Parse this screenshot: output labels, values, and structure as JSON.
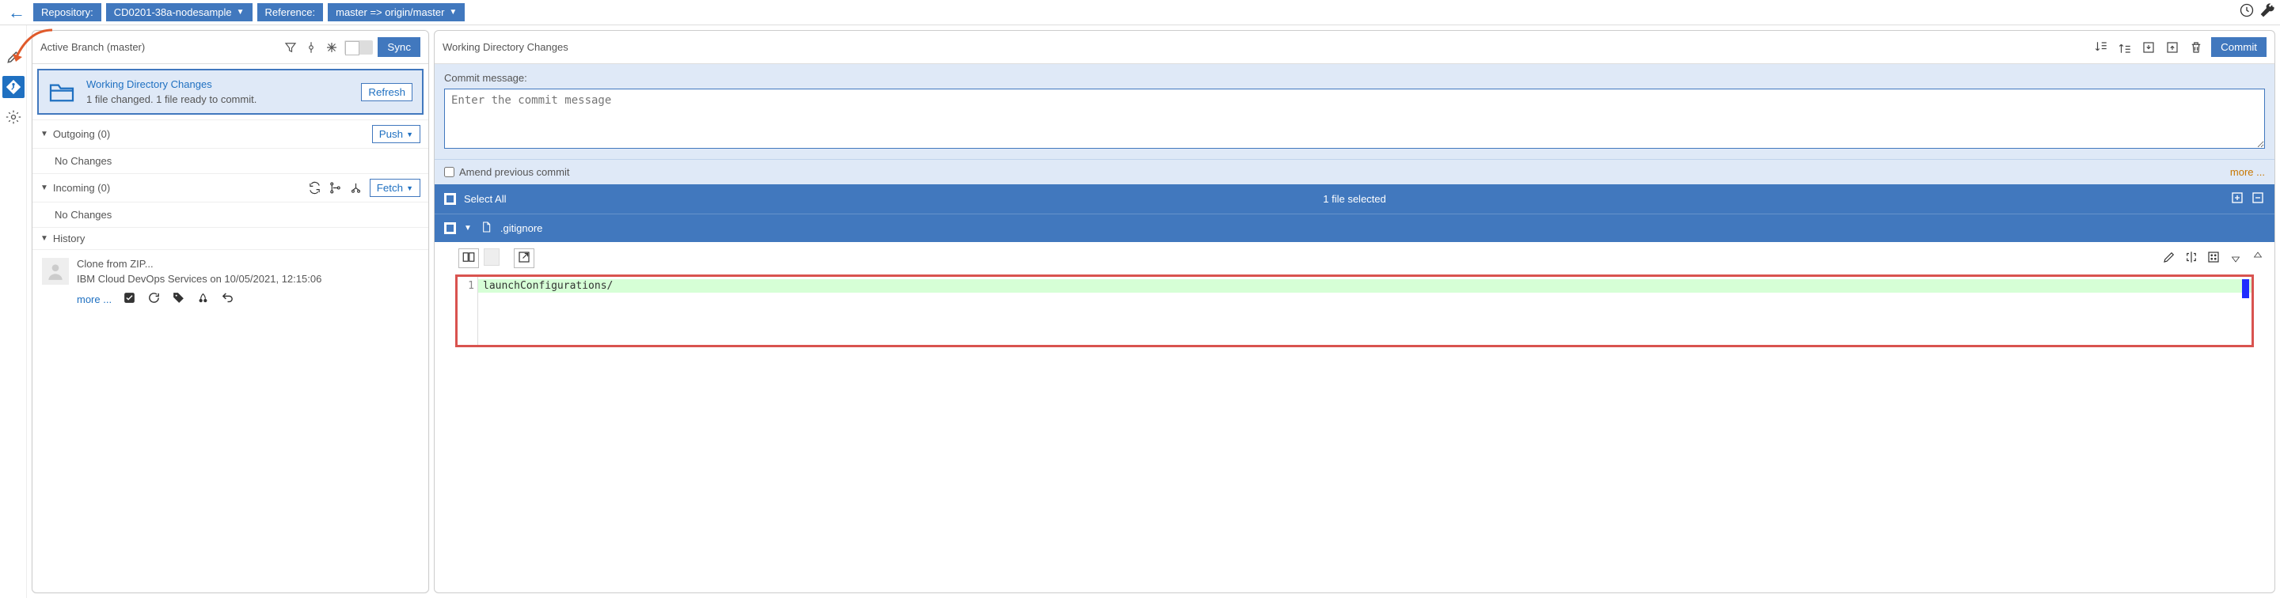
{
  "topbar": {
    "repo_label": "Repository:",
    "repo_value": "CD0201-38a-nodesample",
    "ref_label": "Reference:",
    "ref_value": "master => origin/master"
  },
  "left": {
    "active_branch": "Active Branch (master)",
    "sync_btn": "Sync",
    "wdc_title": "Working Directory Changes",
    "wdc_status": "1 file changed. 1 file ready to commit.",
    "refresh_btn": "Refresh",
    "outgoing_label": "Outgoing (0)",
    "push_btn": "Push",
    "incoming_label": "Incoming (0)",
    "fetch_btn": "Fetch",
    "no_changes": "No Changes",
    "history_label": "History",
    "history_line1": "Clone from ZIP...",
    "history_line2": "IBM Cloud DevOps Services on 10/05/2021, 12:15:06",
    "more": "more ..."
  },
  "right": {
    "title": "Working Directory Changes",
    "commit_btn": "Commit",
    "commit_msg_label": "Commit message:",
    "commit_placeholder": "Enter the commit message",
    "amend_label": "Amend previous commit",
    "more": "more ...",
    "select_all": "Select All",
    "selected_count": "1 file selected",
    "file_name": ".gitignore",
    "diff": {
      "line_no": "1",
      "line_text": "launchConfigurations/"
    }
  }
}
